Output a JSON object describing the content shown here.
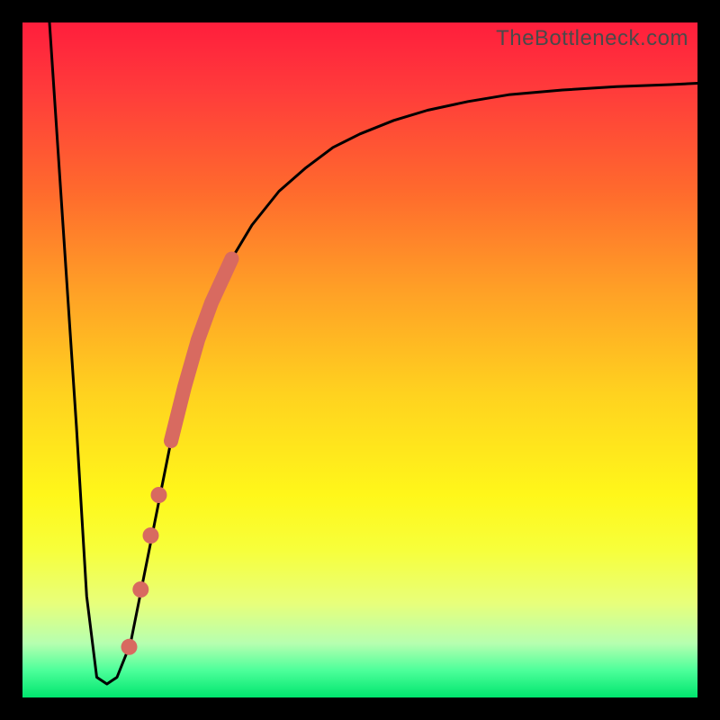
{
  "watermark": "TheBottleneck.com",
  "chart_data": {
    "type": "line",
    "title": "",
    "xlabel": "",
    "ylabel": "",
    "xlim": [
      0,
      100
    ],
    "ylim": [
      0,
      100
    ],
    "grid": false,
    "legend": false,
    "series": [
      {
        "name": "bottleneck-curve",
        "color": "#000000",
        "stroke_width": 3,
        "x": [
          4.0,
          6.0,
          8.0,
          9.5,
          11.0,
          12.5,
          14.0,
          16.0,
          18.0,
          20.0,
          22.0,
          24.0,
          26.0,
          28.0,
          31.0,
          34.0,
          38.0,
          42.0,
          46.0,
          50.0,
          55.0,
          60.0,
          66.0,
          72.0,
          80.0,
          88.0,
          96.0,
          100.0
        ],
        "y": [
          100.0,
          70.0,
          40.0,
          15.0,
          3.0,
          2.0,
          3.0,
          8.0,
          18.0,
          28.0,
          38.0,
          46.0,
          53.0,
          58.5,
          65.0,
          70.0,
          75.0,
          78.5,
          81.5,
          83.5,
          85.5,
          87.0,
          88.3,
          89.3,
          90.0,
          90.5,
          90.8,
          91.0
        ]
      }
    ],
    "thick_band": {
      "name": "highlight-band",
      "color": "#d86a60",
      "stroke_width": 16,
      "x": [
        22.0,
        24.0,
        26.0,
        28.0,
        31.0
      ],
      "y": [
        38.0,
        46.0,
        53.0,
        58.5,
        65.0
      ]
    },
    "markers": {
      "name": "highlight-dots",
      "color": "#d86a60",
      "radius": 9,
      "points": [
        {
          "x": 15.8,
          "y": 7.5
        },
        {
          "x": 17.5,
          "y": 16.0
        },
        {
          "x": 19.0,
          "y": 24.0
        },
        {
          "x": 20.2,
          "y": 30.0
        }
      ]
    }
  }
}
